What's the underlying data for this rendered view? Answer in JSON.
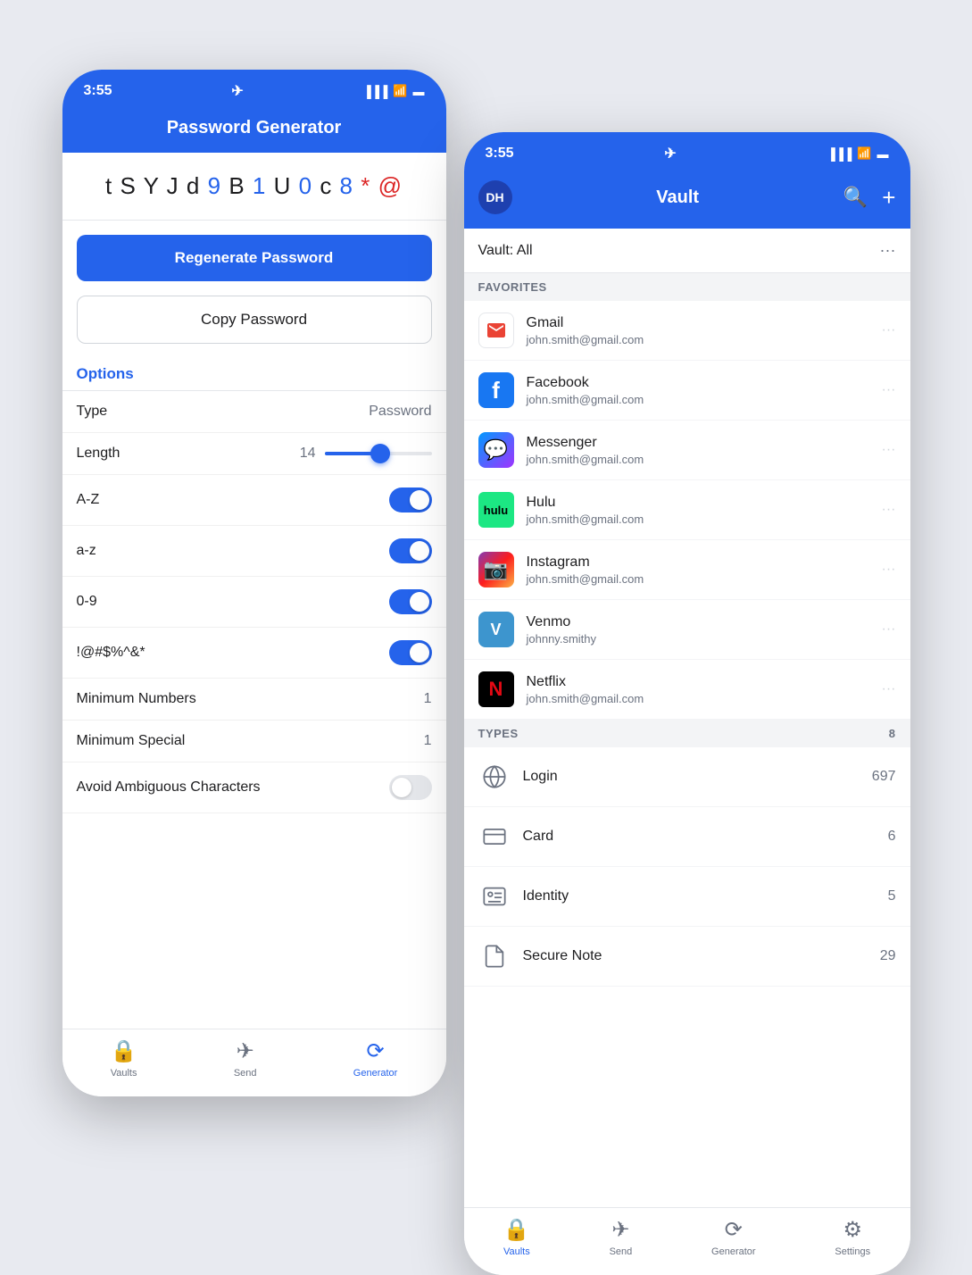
{
  "phone1": {
    "status_time": "3:55",
    "title": "Password Generator",
    "password": {
      "chars": [
        {
          "c": "t",
          "type": "normal"
        },
        {
          "c": "S",
          "type": "normal"
        },
        {
          "c": "Y",
          "type": "normal"
        },
        {
          "c": "J",
          "type": "normal"
        },
        {
          "c": "d",
          "type": "normal"
        },
        {
          "c": "9",
          "type": "digit"
        },
        {
          "c": "B",
          "type": "normal"
        },
        {
          "c": "1",
          "type": "digit"
        },
        {
          "c": "U",
          "type": "normal"
        },
        {
          "c": "0",
          "type": "digit"
        },
        {
          "c": "c",
          "type": "normal"
        },
        {
          "c": "8",
          "type": "digit"
        },
        {
          "c": "*",
          "type": "special"
        },
        {
          "c": "@",
          "type": "special"
        }
      ]
    },
    "regenerate_label": "Regenerate Password",
    "copy_label": "Copy Password",
    "options_label": "Options",
    "type_label": "Type",
    "type_value": "Password",
    "length_label": "Length",
    "length_value": "14",
    "az_label": "A-Z",
    "az_lower_label": "a-z",
    "digits_label": "0-9",
    "special_label": "!@#$%^&*",
    "min_numbers_label": "Minimum Numbers",
    "min_numbers_value": "1",
    "min_special_label": "Minimum Special",
    "min_special_value": "1",
    "avoid_label": "Avoid Ambiguous Characters",
    "nav": {
      "vaults_label": "Vaults",
      "send_label": "Send",
      "generator_label": "Generator"
    }
  },
  "phone2": {
    "status_time": "3:55",
    "avatar_initials": "DH",
    "title": "Vault",
    "vault_selector": "Vault: All",
    "favorites_label": "FAVORITES",
    "types_label": "TYPES",
    "types_count": "8",
    "favorites": [
      {
        "name": "Gmail",
        "sub": "john.smith@gmail.com",
        "icon_type": "gmail"
      },
      {
        "name": "Facebook",
        "sub": "john.smith@gmail.com",
        "icon_type": "facebook"
      },
      {
        "name": "Messenger",
        "sub": "john.smith@gmail.com",
        "icon_type": "messenger"
      },
      {
        "name": "Hulu",
        "sub": "john.smith@gmail.com",
        "icon_type": "hulu"
      },
      {
        "name": "Instagram",
        "sub": "john.smith@gmail.com",
        "icon_type": "instagram"
      },
      {
        "name": "Venmo",
        "sub": "johnny.smithy",
        "icon_type": "venmo"
      },
      {
        "name": "Netflix",
        "sub": "john.smith@gmail.com",
        "icon_type": "netflix"
      }
    ],
    "types": [
      {
        "name": "Login",
        "count": "697",
        "icon": "🌐"
      },
      {
        "name": "Card",
        "count": "6",
        "icon": "💳"
      },
      {
        "name": "Identity",
        "count": "5",
        "icon": "🪪"
      },
      {
        "name": "Secure Note",
        "count": "29",
        "icon": "📄"
      }
    ],
    "nav": {
      "vaults_label": "Vaults",
      "send_label": "Send",
      "generator_label": "Generator",
      "settings_label": "Settings"
    }
  }
}
